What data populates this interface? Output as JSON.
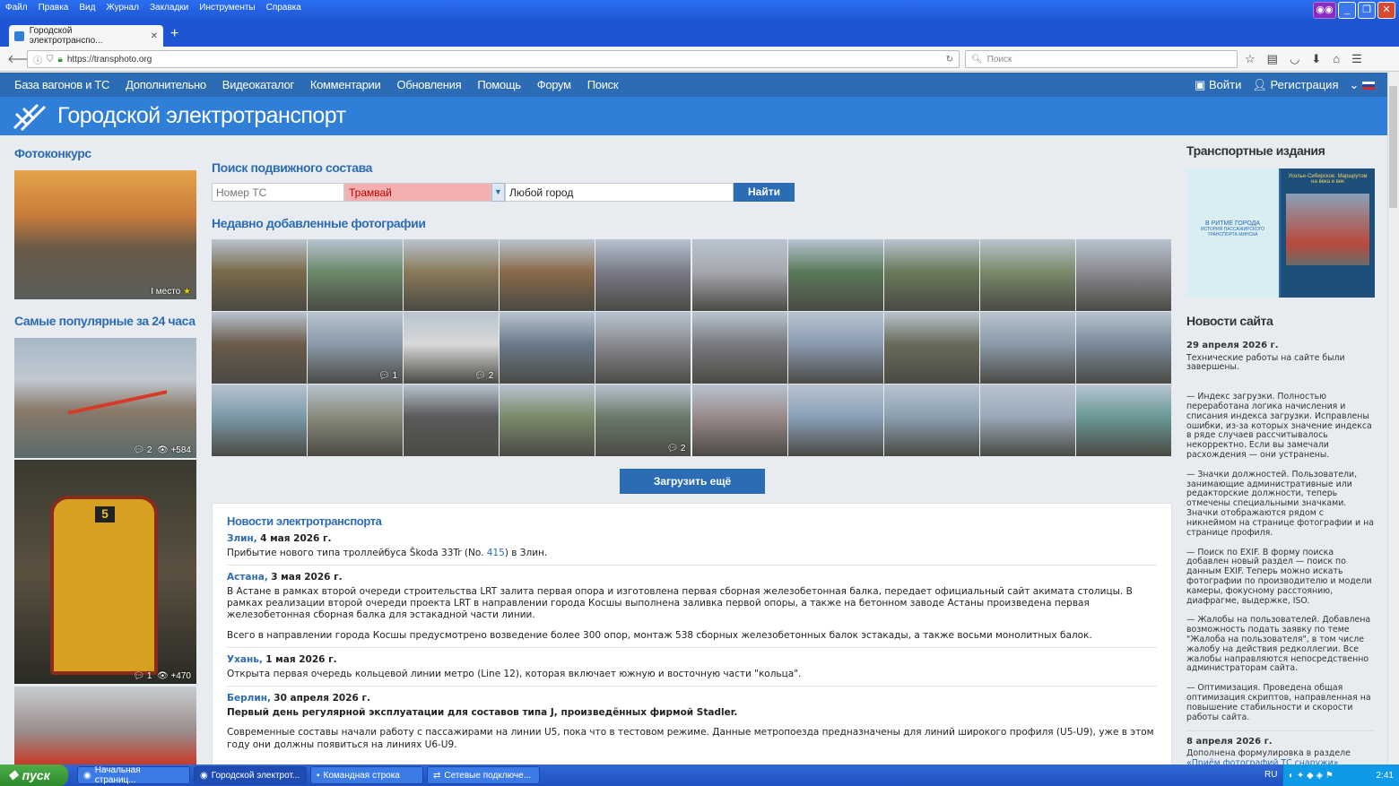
{
  "browser": {
    "menu": [
      "Файл",
      "Правка",
      "Вид",
      "Журнал",
      "Закладки",
      "Инструменты",
      "Справка"
    ],
    "tab_title": "Городской электротранспо...",
    "url": "https://transphoto.org",
    "search_placeholder": "Поиск"
  },
  "site": {
    "nav": [
      "База вагонов и ТС",
      "Дополнительно",
      "Видеокаталог",
      "Комментарии",
      "Обновления",
      "Помощь",
      "Форум",
      "Поиск"
    ],
    "login": "Войти",
    "register": "Регистрация",
    "title": "Городской электротранспорт"
  },
  "left": {
    "contest_title": "Фотоконкурс",
    "contest_place": "I место",
    "popular_title": "Самые популярные за 24 часа",
    "popular": [
      {
        "comments": "2",
        "views": "+584"
      },
      {
        "comments": "1",
        "views": "+470",
        "number": "5"
      }
    ]
  },
  "search": {
    "title": "Поиск подвижного состава",
    "number_placeholder": "Номер ТС",
    "type_value": "Трамвай",
    "city_value": "Любой город",
    "button": "Найти"
  },
  "recent": {
    "title": "Недавно добавленные фотографии",
    "comment_badges": [
      "1",
      "2",
      "2"
    ],
    "load_more": "Загрузить ещё",
    "colors": [
      "#7a6a4a",
      "#6b8a6a",
      "#8a7a5a",
      "#8a6a4a",
      "#7a7a88",
      "#a8a8b0",
      "#5a7a5a",
      "#6a7a5a",
      "#7a8a6a",
      "#8a8a90",
      "#6a5a4a",
      "#8a9aa8",
      "#d8d8d8",
      "#6a7a8a",
      "#8a8a90",
      "#7a7a80",
      "#8a9ab0",
      "#6a6a5a",
      "#8a9aa8",
      "#7a8a9a",
      "#7a9aa8",
      "#8a8a7a",
      "#5a5a5a",
      "#7a8a6a",
      "#6a7a6a",
      "#9a8a8a",
      "#8aa0b8",
      "#8aa0b0",
      "#9aa8b8",
      "#6a9a98"
    ]
  },
  "news": {
    "title": "Новости электротранспорта",
    "items": [
      {
        "city": "Злин,",
        "date": "4 мая 2026 г.",
        "text_before": "Прибытие нового типа троллейбуса Škoda 33Tr (No. ",
        "link": "415",
        "text_after": ") в Злин."
      },
      {
        "city": "Астана,",
        "date": "3 мая 2026 г.",
        "p1": "В Астане в рамках второй очереди строительства LRT залита первая опора и изготовлена первая сборная железобетонная балка, передает официальный сайт акимата столицы. В рамках реализации второй очереди проекта LRT в направлении города Косшы выполнена заливка первой опоры, а также на бетонном заводе Астаны произведена первая железобетонная сборная балка для эстакадной части линии.",
        "p2": "Всего в направлении города Косшы предусмотрено возведение более 300 опор, монтаж 538 сборных железобетонных балок эстакады, а также восьми монолитных балок."
      },
      {
        "city": "Ухань,",
        "date": "1 мая 2026 г.",
        "text": "Открыта первая очередь кольцевой линии метро (Line 12), которая включает южную и восточную части \"кольца\"."
      },
      {
        "city": "Берлин,",
        "date": "30 апреля 2026 г.",
        "headline": "Первый день регулярной эксплуатации для составов типа J, произведённых фирмой Stadler.",
        "text": "Современные составы начали работу с пассажирами на линии U5, пока что в тестовом режиме. Данные метропоезда предназначены для линий широкого профиля (U5-U9), уже в этом году они должны появиться на линиях U6-U9."
      }
    ]
  },
  "right": {
    "editions_title": "Транспортные издания",
    "book1_title": "В РИТМЕ ГОРОДА",
    "book1_sub": "ИСТОРИЯ ПАССАЖИРСКОГО ТРАНСПОРТА МИНСКА",
    "book2_title": "Усолье-Сибирское. Маршрутом на века и век",
    "site_news_title": "Новости сайта",
    "entries": [
      {
        "date": "29 апреля 2026 г.",
        "paras": [
          "Технические работы на сайте были завершены.",
          "— Индекс загрузки. Полностью переработана логика начисления и списания индекса загрузки. Исправлены ошибки, из-за которых значение индекса в ряде случаев рассчитывалось некорректно. Если вы замечали расхождения — они устранены.",
          "— Значки должностей. Пользователи, занимающие административные или редакторские должности, теперь отмечены специальными значками. Значки отображаются рядом с никнеймом на странице фотографии и на странице профиля.",
          "— Поиск по EXIF. В форму поиска добавлен новый раздел — поиск по данным EXIF. Теперь можно искать фотографии по производителю и модели камеры, фокусному расстоянию, диафрагме, выдержке, ISO.",
          "— Жалобы на пользователей. Добавлена возможность подать заявку по теме \"Жалоба на пользователя\", в том числе жалобу на действия редколлегии. Все жалобы направляются непосредственно администраторам сайта.",
          "— Оптимизация. Проведена общая оптимизация скриптов, направленная на повышение стабильности и скорости работы сайта."
        ]
      },
      {
        "date": "8 апреля 2026 г.",
        "text": "Дополнена формулировка в разделе",
        "link": "«Приём фотографий ТС снаружи»"
      }
    ]
  },
  "taskbar": {
    "start": "пуск",
    "buttons": [
      "Начальная страниц...",
      "Городской электрот...",
      "Командная строка",
      "Сетевые подключе..."
    ],
    "lang": "RU",
    "clock": "2:41"
  }
}
